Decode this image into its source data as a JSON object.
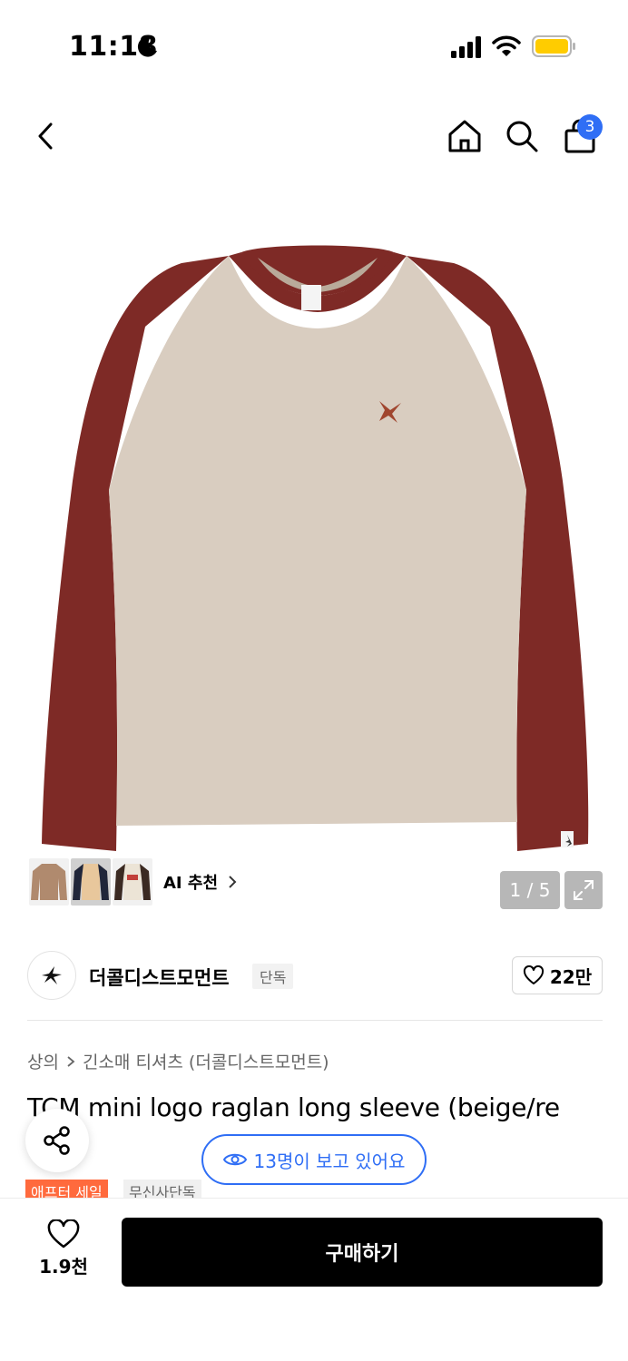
{
  "status_bar": {
    "time": "11:18"
  },
  "header": {
    "cart_count": "3"
  },
  "gallery": {
    "page_indicator": "1 / 5",
    "ai_recommend_label": "AI 추천"
  },
  "brand": {
    "name": "더콜디스트모먼트",
    "tag": "단독",
    "like_count": "22만"
  },
  "breadcrumb": {
    "category": "상의",
    "subcategory": "긴소매 티셔츠 (더콜디스트모먼트)"
  },
  "product": {
    "title": "TCM mini logo raglan long sleeve (beige/re",
    "viewers": "13명이 보고 있어요",
    "tags": [
      "애프터 세일",
      "무신사단독"
    ]
  },
  "bottom_bar": {
    "like_count": "1.9천",
    "buy_label": "구매하기"
  },
  "colors": {
    "accent_blue": "#2f6ef5",
    "sale_orange": "#ff6a3d",
    "shirt_body": "#d9cdc0",
    "shirt_sleeve": "#7e2a26"
  }
}
